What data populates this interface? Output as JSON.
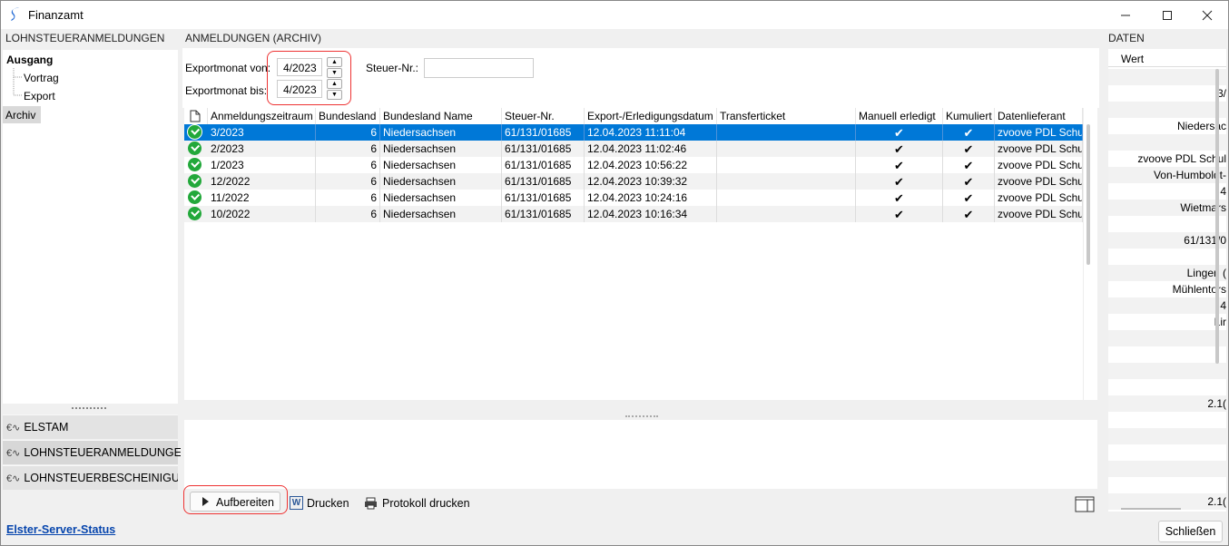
{
  "window": {
    "title": "Finanzamt"
  },
  "panes": {
    "left_header": "LOHNSTEUERANMELDUNGEN",
    "center_header": "ANMELDUNGEN (ARCHIV)",
    "right_header": "DATEN"
  },
  "tree": {
    "root": "Ausgang",
    "child1": "Vortrag",
    "child2": "Export",
    "archive": "Archiv"
  },
  "nav": {
    "elstam": "ELSTAM",
    "lsta": "LOHNSTEUERANMELDUNGEN",
    "lstb": "LOHNSTEUERBESCHEINIGUNGE"
  },
  "filter": {
    "von_label": "Exportmonat von:",
    "von_value": "4/2023",
    "bis_label": "Exportmonat bis:",
    "bis_value": "4/2023",
    "steuer_label": "Steuer-Nr.:",
    "steuer_value": ""
  },
  "grid": {
    "columns": [
      "Anmeldungszeitraum",
      "Bundesland",
      "Bundesland Name",
      "Steuer-Nr.",
      "Export-/Erledigungsdatum",
      "Transferticket",
      "Manuell erledigt",
      "Kumuliert",
      "Datenlieferant"
    ],
    "rows": [
      {
        "period": "3/2023",
        "land": "6",
        "land_name": "Niedersachsen",
        "steuer": "61/131/01685",
        "date": "12.04.2023 11:11:04",
        "ticket": "",
        "manual": "✔",
        "kum": "✔",
        "lieferant": "zvoove PDL Schul"
      },
      {
        "period": "2/2023",
        "land": "6",
        "land_name": "Niedersachsen",
        "steuer": "61/131/01685",
        "date": "12.04.2023 11:02:46",
        "ticket": "",
        "manual": "✔",
        "kum": "✔",
        "lieferant": "zvoove PDL Schul"
      },
      {
        "period": "1/2023",
        "land": "6",
        "land_name": "Niedersachsen",
        "steuer": "61/131/01685",
        "date": "12.04.2023 10:56:22",
        "ticket": "",
        "manual": "✔",
        "kum": "✔",
        "lieferant": "zvoove PDL Schul"
      },
      {
        "period": "12/2022",
        "land": "6",
        "land_name": "Niedersachsen",
        "steuer": "61/131/01685",
        "date": "12.04.2023 10:39:32",
        "ticket": "",
        "manual": "✔",
        "kum": "✔",
        "lieferant": "zvoove PDL Schul"
      },
      {
        "period": "11/2022",
        "land": "6",
        "land_name": "Niedersachsen",
        "steuer": "61/131/01685",
        "date": "12.04.2023 10:24:16",
        "ticket": "",
        "manual": "✔",
        "kum": "✔",
        "lieferant": "zvoove PDL Schul"
      },
      {
        "period": "10/2022",
        "land": "6",
        "land_name": "Niedersachsen",
        "steuer": "61/131/01685",
        "date": "12.04.2023 10:16:34",
        "ticket": "",
        "manual": "✔",
        "kum": "✔",
        "lieferant": "zvoove PDL Schul"
      }
    ]
  },
  "toolbar": {
    "aufbereiten": "Aufbereiten",
    "drucken": "Drucken",
    "protokoll": "Protokoll drucken"
  },
  "daten": {
    "header": "Wert",
    "values": [
      "",
      "3/",
      "",
      "Niedersac",
      "",
      "zvoove PDL Schul",
      "Von-Humboldt-",
      "4",
      "Wietmars",
      "",
      "61/131/0",
      "",
      "Lingen (",
      "Mühlentors",
      "4",
      "Lir",
      "",
      "",
      "",
      "",
      "2.1(",
      "",
      "",
      "",
      "",
      "",
      "2.1("
    ]
  },
  "status": {
    "server_link": "Elster-Server-Status",
    "close": "Schließen"
  },
  "colors": {
    "selection": "#0078d7",
    "ok_green": "#22a83a",
    "highlight_red": "#e33333"
  }
}
